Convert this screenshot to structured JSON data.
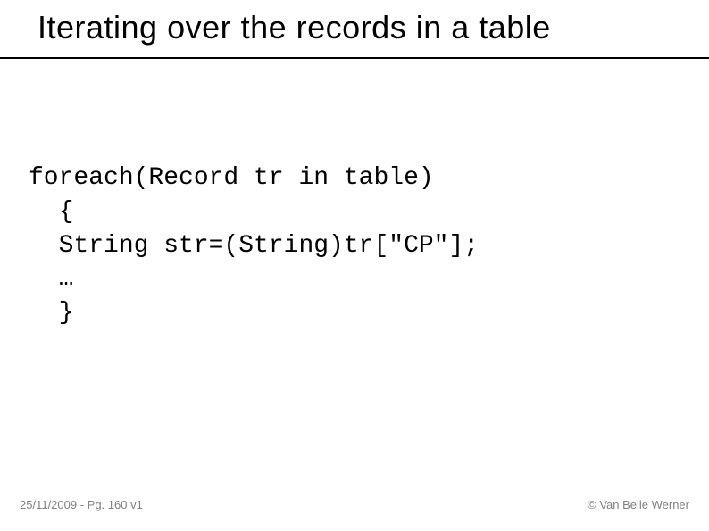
{
  "slide": {
    "title": "Iterating over the records in a table",
    "code": "foreach(Record tr in table)\n  {\n  String str=(String)tr[\"CP\"];\n  …\n  }",
    "footer": {
      "date_page": "25/11/2009 - Pg. 160 v1",
      "copyright": "© Van Belle Werner"
    }
  }
}
